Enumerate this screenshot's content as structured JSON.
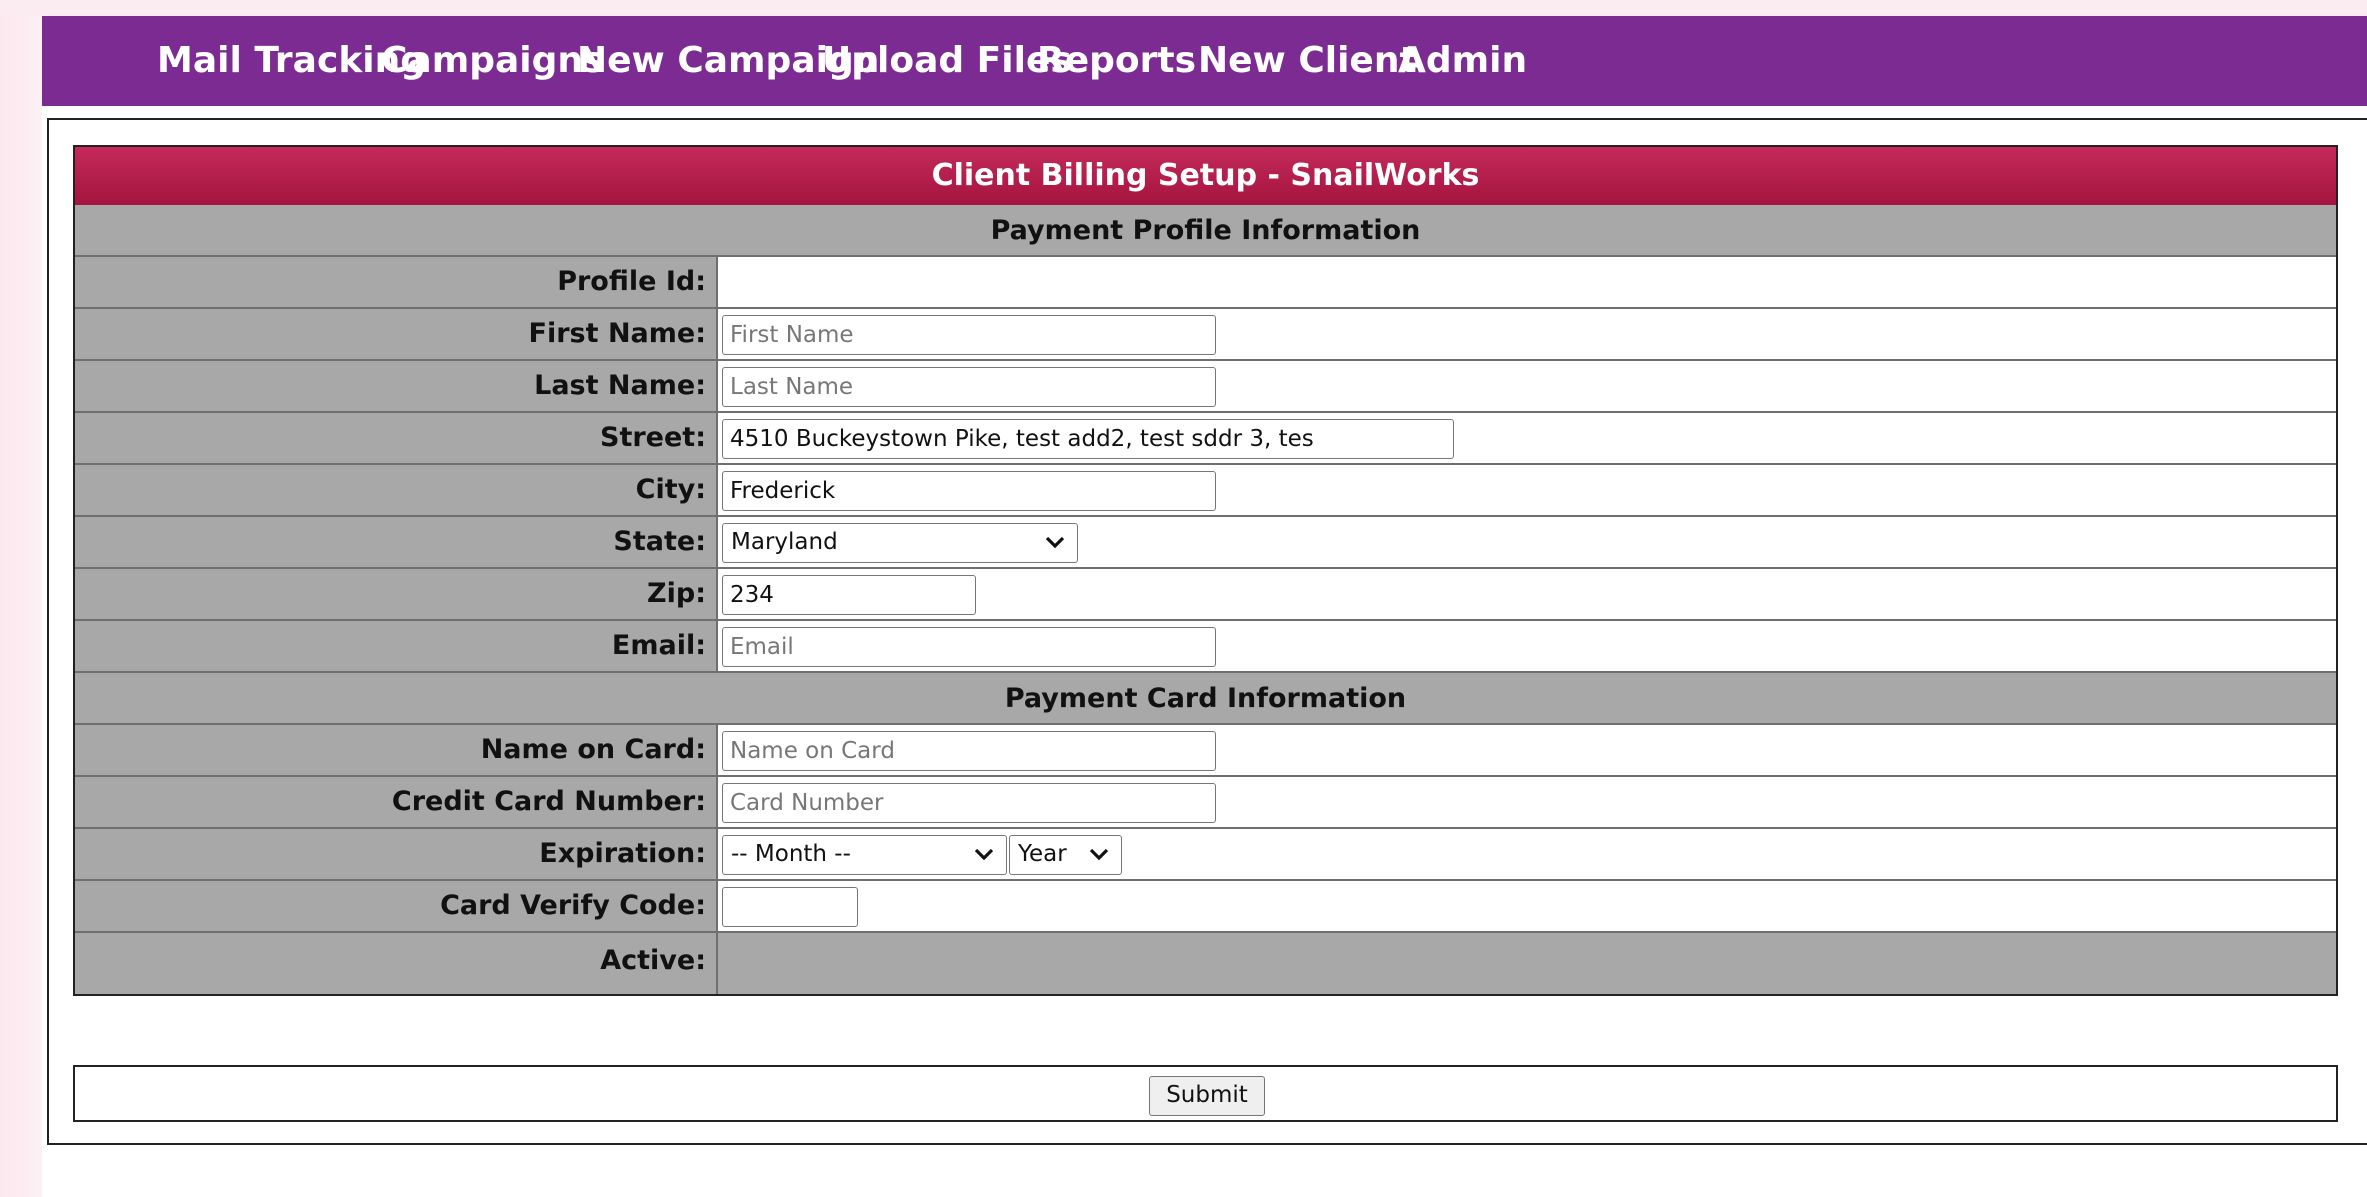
{
  "nav": {
    "items": [
      {
        "label": "Mail Tracking"
      },
      {
        "label": "Campaigns"
      },
      {
        "label": "New Campaign"
      },
      {
        "label": "Upload Files"
      },
      {
        "label": "Reports"
      },
      {
        "label": "New Client"
      },
      {
        "label": "Admin"
      }
    ]
  },
  "form": {
    "title": "Client Billing Setup - SnailWorks",
    "profile_section": "Payment Profile Information",
    "card_section": "Payment Card Information",
    "profile_id": {
      "label": "Profile Id:",
      "value": ""
    },
    "first_name": {
      "label": "First Name:",
      "value": "",
      "placeholder": "First Name"
    },
    "last_name": {
      "label": "Last Name:",
      "value": "",
      "placeholder": "Last Name"
    },
    "street": {
      "label": "Street:",
      "value": "4510 Buckeystown Pike, test add2, test sddr 3, tes",
      "placeholder": ""
    },
    "city": {
      "label": "City:",
      "value": "Frederick",
      "placeholder": ""
    },
    "state": {
      "label": "State:",
      "selected": "Maryland"
    },
    "zip": {
      "label": "Zip:",
      "value": "234",
      "placeholder": ""
    },
    "email": {
      "label": "Email:",
      "value": "",
      "placeholder": "Email"
    },
    "name_on_card": {
      "label": "Name on Card:",
      "value": "",
      "placeholder": "Name on Card"
    },
    "card_number": {
      "label": "Credit Card Number:",
      "value": "",
      "placeholder": "Card Number"
    },
    "expiration": {
      "label": "Expiration:",
      "month": "-- Month --",
      "year": "Year"
    },
    "cvv": {
      "label": "Card Verify Code:",
      "value": "",
      "placeholder": ""
    },
    "active": {
      "label": "Active:"
    },
    "submit_label": "Submit"
  },
  "colors": {
    "nav_bg": "#7b2b91",
    "title_bg": "#b01e4a",
    "label_bg": "#a8a8a8"
  }
}
